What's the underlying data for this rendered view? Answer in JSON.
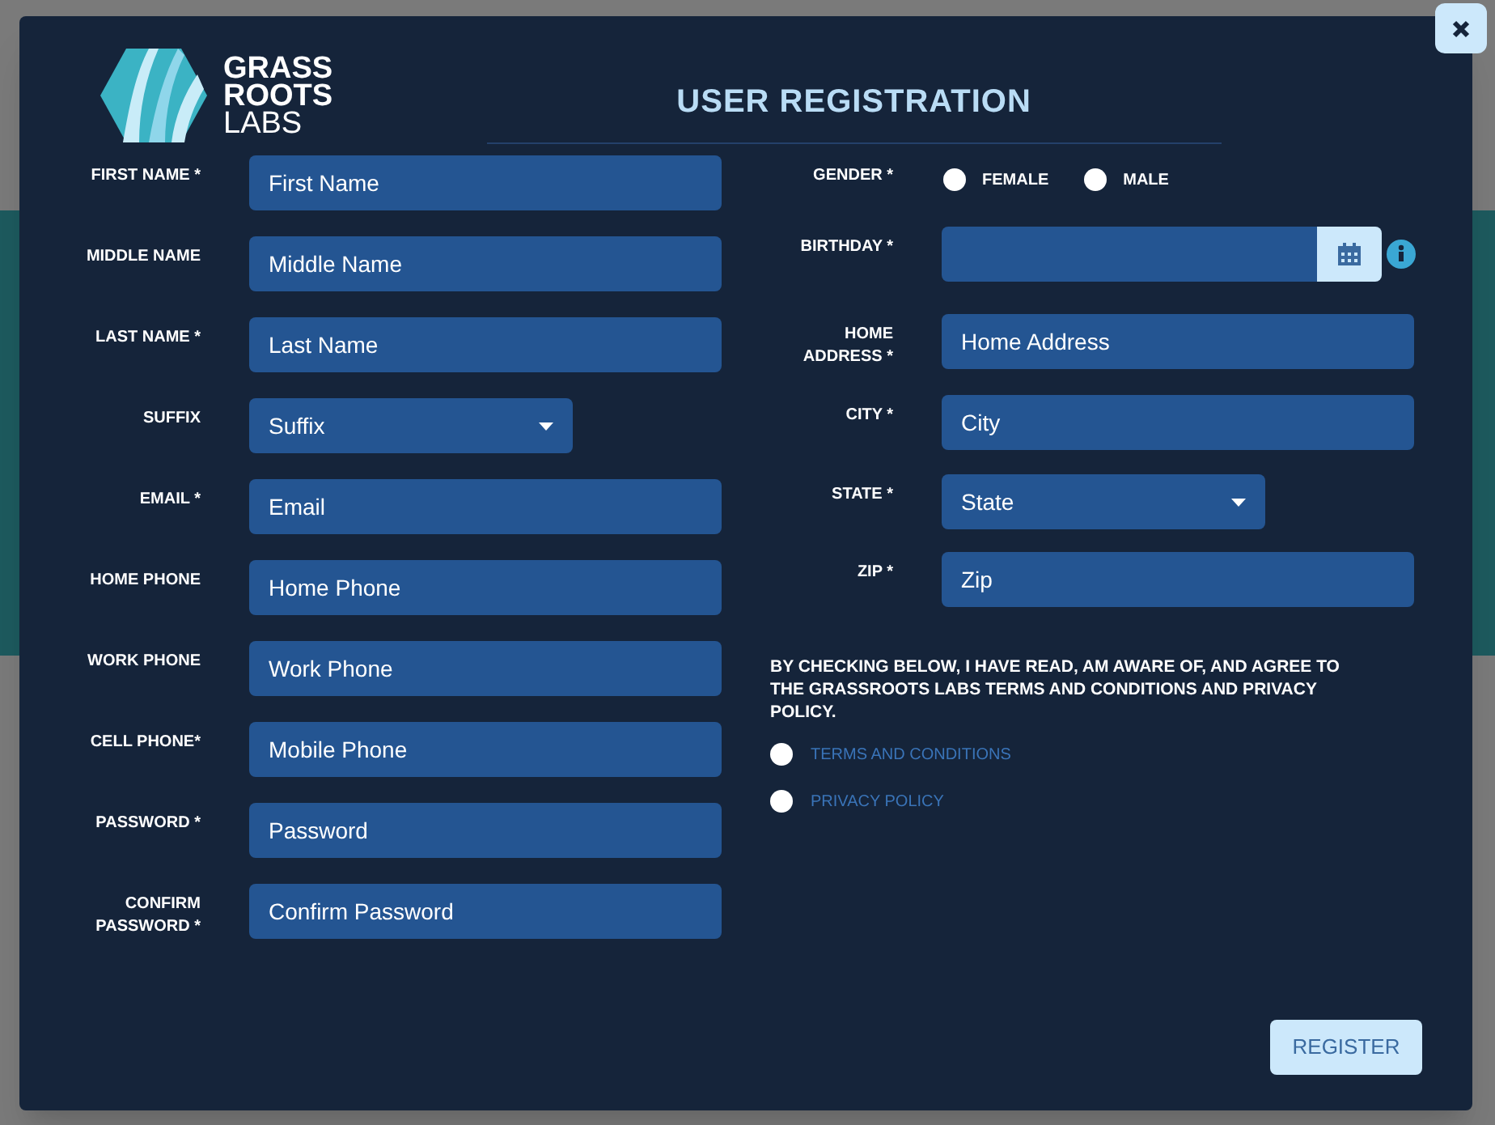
{
  "logo": {
    "lines": [
      "GRASS",
      "ROOTS",
      "LABS"
    ]
  },
  "title": "USER REGISTRATION",
  "left_fields": [
    {
      "label": "FIRST NAME *",
      "kind": "text",
      "placeholder": "First Name"
    },
    {
      "label": "MIDDLE NAME",
      "kind": "text",
      "placeholder": "Middle Name"
    },
    {
      "label": "LAST NAME *",
      "kind": "text",
      "placeholder": "Last Name"
    },
    {
      "label": "SUFFIX",
      "kind": "select",
      "value": "Suffix"
    },
    {
      "label": "EMAIL *",
      "kind": "text",
      "placeholder": "Email"
    },
    {
      "label": "HOME PHONE",
      "kind": "text",
      "placeholder": "Home Phone"
    },
    {
      "label": "WORK PHONE",
      "kind": "text",
      "placeholder": "Work Phone"
    },
    {
      "label": "CELL PHONE*",
      "kind": "text",
      "placeholder": "Mobile Phone"
    },
    {
      "label": "PASSWORD *",
      "kind": "text",
      "placeholder": "Password"
    },
    {
      "label": "CONFIRM PASSWORD *",
      "kind": "text",
      "placeholder": "Confirm Password"
    }
  ],
  "right_fields": [
    {
      "label": "GENDER *",
      "kind": "radio",
      "options": [
        {
          "label": "FEMALE",
          "selected": false
        },
        {
          "label": "MALE",
          "selected": false
        }
      ]
    },
    {
      "label": "BIRTHDAY *",
      "kind": "date"
    },
    {
      "label": "HOME ADDRESS *",
      "kind": "text",
      "placeholder": "Home Address"
    },
    {
      "label": "CITY *",
      "kind": "text",
      "placeholder": "City"
    },
    {
      "label": "STATE *",
      "kind": "select",
      "value": "State"
    },
    {
      "label": "ZIP *",
      "kind": "text",
      "placeholder": "Zip"
    }
  ],
  "consent": {
    "text": "BY CHECKING BELOW, I HAVE READ, AM AWARE OF, AND AGREE TO THE GRASSROOTS LABS TERMS AND CONDITIONS AND PRIVACY POLICY.",
    "options": [
      {
        "label": "TERMS AND CONDITIONS",
        "checked": false
      },
      {
        "label": "PRIVACY POLICY",
        "checked": false
      }
    ]
  },
  "register_button": {
    "label": "REGISTER"
  }
}
